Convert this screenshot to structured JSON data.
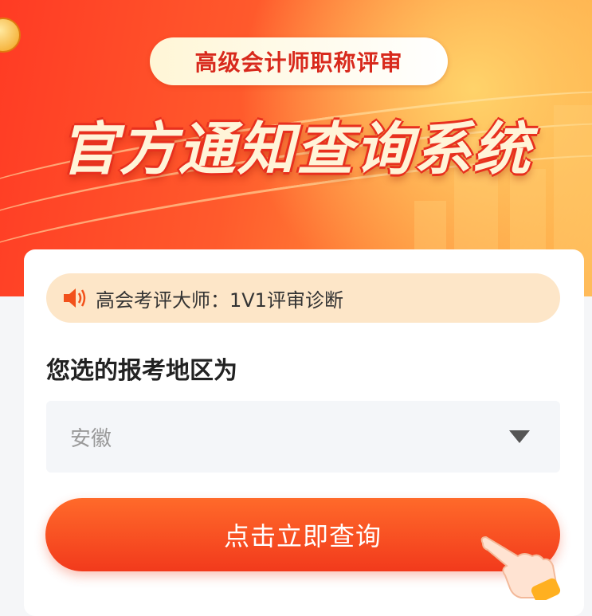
{
  "header": {
    "badge": "高级会计师职称评审",
    "headline": "官方通知查询系统"
  },
  "notice": {
    "icon": "speaker-icon",
    "text": "高会考评大师：1V1评审诊断"
  },
  "region": {
    "title": "您选的报考地区为",
    "selected": "安徽",
    "dropdown_icon": "chevron-down-icon"
  },
  "cta": {
    "label": "点击立即查询",
    "icon": "pointing-hand-icon"
  },
  "colors": {
    "primary": "#f23a1c",
    "notice_bg": "#fde6c8",
    "select_bg": "#f4f6f9"
  }
}
